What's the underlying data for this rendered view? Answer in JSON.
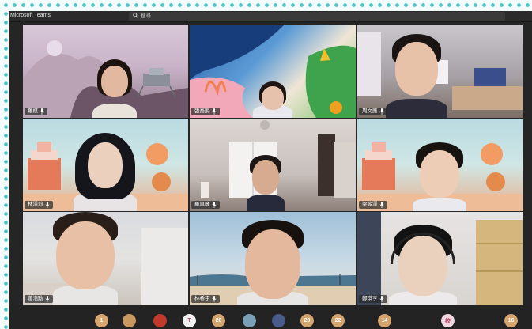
{
  "app": {
    "title": "Microsoft Teams",
    "search_placeholder": "搜尋"
  },
  "participants": [
    {
      "name": "羅棋"
    },
    {
      "name": "張喬熙"
    },
    {
      "name": "周文應"
    },
    {
      "name": "林澤莉"
    },
    {
      "name": "羅卓峰"
    },
    {
      "name": "梁峻澤"
    },
    {
      "name": "蕭浩勳"
    },
    {
      "name": "林希宇"
    },
    {
      "name": "鄭琪亨"
    }
  ],
  "roster": [
    {
      "label": "1",
      "color": "#d9a66f"
    },
    {
      "label": "",
      "color": "#c99860"
    },
    {
      "label": "",
      "color": "#c0392b"
    },
    {
      "label": "T",
      "color": "#f2f2f2"
    },
    {
      "label": "20",
      "color": "#d4a46c"
    },
    {
      "label": "",
      "color": "#7aa0b8"
    },
    {
      "label": "",
      "color": "#4a5a8a"
    },
    {
      "label": "20",
      "color": "#d4a46c"
    },
    {
      "label": "22",
      "color": "#d4a46c"
    },
    {
      "label": "14",
      "color": "#d4a46c"
    },
    {
      "label": "校",
      "color": "#f0d6e0"
    },
    {
      "label": "16",
      "color": "#d4a46c"
    }
  ]
}
